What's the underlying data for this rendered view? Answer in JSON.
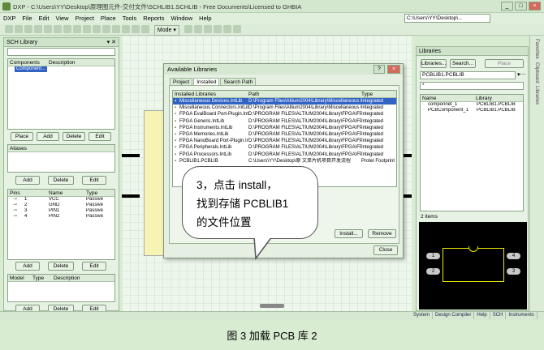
{
  "app": {
    "title": "DXP - C:\\Users\\YY\\Desktop\\原理图元件-交付文件\\SCHLIB1.SCHLIB - Free Documents\\Licensed to GHBIA",
    "path_box": "C:\\Users\\YY\\Desktop\\...",
    "window_buttons": [
      "_",
      "□",
      "×"
    ]
  },
  "menu": [
    "DXP",
    "File",
    "Edit",
    "View",
    "Project",
    "Place",
    "Tools",
    "Reports",
    "Window",
    "Help"
  ],
  "toolbar": {
    "mode_label": "Mode ▾"
  },
  "sch_library": {
    "title": "SCH Library",
    "pin_label": "▾ ✕",
    "components_header": {
      "col1": "Components",
      "col2": "Description"
    },
    "components": [
      {
        "name": "Component...",
        "selected": true
      }
    ],
    "comp_buttons": [
      "Place",
      "Add",
      "Delete",
      "Edit"
    ],
    "aliases_header": "Aliases",
    "alias_buttons": [
      "Add",
      "Delete",
      "Edit"
    ],
    "pins_header": {
      "col1": "Pins",
      "col2": "Name",
      "col3": "Type"
    },
    "pins": [
      {
        "num": "1",
        "name": "VCC",
        "type": "Passive"
      },
      {
        "num": "2",
        "name": "GND",
        "type": "Passive"
      },
      {
        "num": "3",
        "name": "PIN1",
        "type": "Passive"
      },
      {
        "num": "4",
        "name": "PIN2",
        "type": "Passive"
      }
    ],
    "pin_buttons": [
      "Add",
      "Delete",
      "Edit"
    ],
    "model_header": {
      "col1": "Model",
      "col2": "Type",
      "col3": "Description"
    },
    "model_buttons": [
      "Add",
      "Delete",
      "Edit"
    ]
  },
  "dialog": {
    "title": "Available Libraries",
    "help_btn": "?",
    "close_btn": "×",
    "tabs": [
      "Project",
      "Installed",
      "Search Path"
    ],
    "active_tab": "Installed",
    "columns": [
      "Installed Libraries",
      "Path",
      "Type"
    ],
    "rows": [
      {
        "name": "Miscellaneous Devices.IntLib",
        "path": "D:\\Program Files\\Altium2004\\Library\\Miscellaneous Devic",
        "type": "Integrated",
        "selected": true
      },
      {
        "name": "Miscellaneous Connectors.IntLib",
        "path": "D:\\Program Files\\Altium2004\\Library\\Miscellaneous Conn",
        "type": "Integrated"
      },
      {
        "name": "FPGA EvalBoard Port-Plugin.IntLib",
        "path": "D:\\PROGRAM FILES\\ALTIUM2004\\Library\\FPGA\\FPGA",
        "type": "Integrated"
      },
      {
        "name": "FPGA Generic.IntLib",
        "path": "D:\\PROGRAM FILES\\ALTIUM2004\\Library\\FPGA\\FPGA",
        "type": "Integrated"
      },
      {
        "name": "FPGA Instruments.IntLib",
        "path": "D:\\PROGRAM FILES\\ALTIUM2004\\Library\\FPGA\\FPGA",
        "type": "Integrated"
      },
      {
        "name": "FPGA Memories.IntLib",
        "path": "D:\\PROGRAM FILES\\ALTIUM2004\\Library\\FPGA\\FPGA",
        "type": "Integrated"
      },
      {
        "name": "FPGA NanoBoard Port-Plugin.IntLib",
        "path": "D:\\PROGRAM FILES\\ALTIUM2004\\Library\\FPGA\\FPGA",
        "type": "Integrated"
      },
      {
        "name": "FPGA Peripherals.IntLib",
        "path": "D:\\PROGRAM FILES\\ALTIUM2004\\Library\\FPGA\\FPGA",
        "type": "Integrated"
      },
      {
        "name": "FPGA Processors.IntLib",
        "path": "D:\\PROGRAM FILES\\ALTIUM2004\\Library\\FPGA\\FPGA",
        "type": "Integrated"
      },
      {
        "name": "PCBLIB1.PCBLIB",
        "path": "C:\\Users\\YY\\Desktop\\原 文单片机项目开发流程",
        "type": "Protel Footprint L"
      }
    ],
    "buttons": {
      "install": "Install...",
      "remove": "Remove",
      "close": "Close"
    }
  },
  "callout": {
    "line1": "3，点击 install，",
    "line2": "找到存储 PCBLIB1",
    "line3": "的文件位置"
  },
  "libraries_panel": {
    "title": "Libraries",
    "buttons": {
      "libraries": "Libraries...",
      "search": "Search...",
      "place": "Place"
    },
    "selected_lib": "PCBLIB1.PCBLIB",
    "filter": "*",
    "columns": [
      "Name",
      "Library"
    ],
    "items": [
      {
        "name": "componnet_1",
        "library": "PCBLIB1.PCBLIB"
      },
      {
        "name": "PCBComponent_1",
        "library": "PCBLIB1.PCBLIB"
      }
    ],
    "count": "2 items",
    "footprint_pins": [
      "1",
      "2",
      "4",
      "3"
    ]
  },
  "right_tabs": [
    "Favorites",
    "Clipboard",
    "Libraries"
  ],
  "bottom_tabs": [
    "System",
    "Design Compiler",
    "Help",
    "SCH",
    "Instruments"
  ],
  "caption": "图 3  加载 PCB 库 2"
}
